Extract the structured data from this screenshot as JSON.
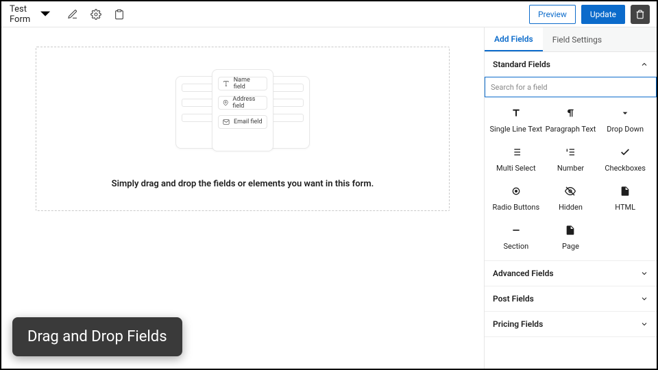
{
  "header": {
    "form_name": "Test Form",
    "preview_label": "Preview",
    "update_label": "Update"
  },
  "canvas": {
    "empty_hint": "Simply drag and drop the fields or elements you want in this form.",
    "sample_chips": [
      "Name field",
      "Address field",
      "Email field"
    ]
  },
  "sidebar": {
    "tabs": {
      "add_fields": "Add Fields",
      "field_settings": "Field Settings"
    },
    "search_placeholder": "Search for a field",
    "sections": {
      "standard": "Standard Fields",
      "advanced": "Advanced Fields",
      "post": "Post Fields",
      "pricing": "Pricing Fields"
    },
    "standard_fields": [
      "Single Line Text",
      "Paragraph Text",
      "Drop Down",
      "Multi Select",
      "Number",
      "Checkboxes",
      "Radio Buttons",
      "Hidden",
      "HTML",
      "Section",
      "Page"
    ]
  },
  "toast": {
    "message": "Drag and Drop Fields"
  }
}
